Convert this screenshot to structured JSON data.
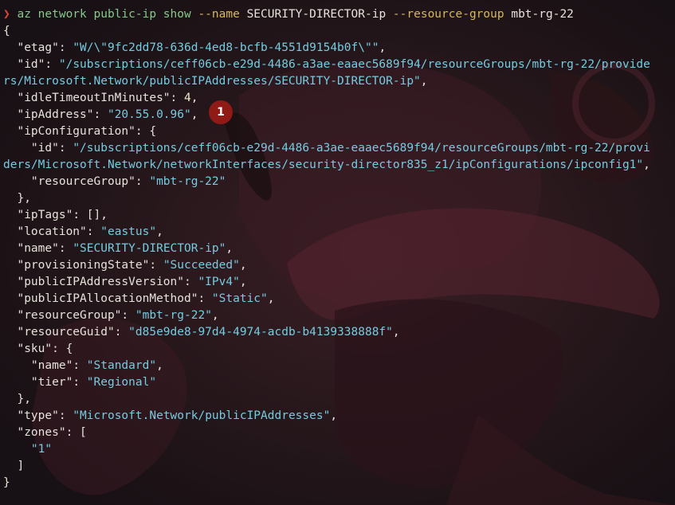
{
  "prompt": {
    "arrow": "❯",
    "command": "az network public-ip show",
    "name_flag": "--name",
    "name_value": "SECURITY-DIRECTOR-ip",
    "rg_flag": "--resource-group",
    "rg_value": "mbt-rg-22"
  },
  "output": {
    "open_brace": "{",
    "close_brace": "}",
    "etag_key": "\"etag\"",
    "etag_value": "\"W/\\\"9fc2dd78-636d-4ed8-bcfb-4551d9154b0f\\\"\"",
    "id_key": "\"id\"",
    "id_value_line1": "\"/subscriptions/ceff06cb-e29d-4486-a3ae-eaaec5689f94/resourceGroups/mbt-rg-22/provide",
    "id_value_line2": "rs/Microsoft.Network/publicIPAddresses/SECURITY-DIRECTOR-ip\"",
    "idle_key": "\"idleTimeoutInMinutes\"",
    "idle_value": "4",
    "ip_key": "\"ipAddress\"",
    "ip_value": "\"20.55.0.96\"",
    "ipconfig_key": "\"ipConfiguration\"",
    "ipconfig_id_key": "\"id\"",
    "ipconfig_id_line1": "\"/subscriptions/ceff06cb-e29d-4486-a3ae-eaaec5689f94/resourceGroups/mbt-rg-22/provi",
    "ipconfig_id_line2": "ders/Microsoft.Network/networkInterfaces/security-director835_z1/ipConfigurations/ipconfig1\"",
    "ipconfig_rg_key": "\"resourceGroup\"",
    "ipconfig_rg_value": "\"mbt-rg-22\"",
    "iptags_key": "\"ipTags\"",
    "iptags_value": "[]",
    "location_key": "\"location\"",
    "location_value": "\"eastus\"",
    "name_key": "\"name\"",
    "name_value": "\"SECURITY-DIRECTOR-ip\"",
    "prov_key": "\"provisioningState\"",
    "prov_value": "\"Succeeded\"",
    "ipver_key": "\"publicIPAddressVersion\"",
    "ipver_value": "\"IPv4\"",
    "alloc_key": "\"publicIPAllocationMethod\"",
    "alloc_value": "\"Static\"",
    "rg_key": "\"resourceGroup\"",
    "rg_value": "\"mbt-rg-22\"",
    "guid_key": "\"resourceGuid\"",
    "guid_value": "\"d85e9de8-97d4-4974-acdb-b4139338888f\"",
    "sku_key": "\"sku\"",
    "sku_name_key": "\"name\"",
    "sku_name_value": "\"Standard\"",
    "sku_tier_key": "\"tier\"",
    "sku_tier_value": "\"Regional\"",
    "type_key": "\"type\"",
    "type_value": "\"Microsoft.Network/publicIPAddresses\"",
    "zones_key": "\"zones\"",
    "zones_item": "\"1\""
  },
  "badge": {
    "label": "1"
  },
  "colors": {
    "background": "#1c1417",
    "string": "#76cbe0",
    "command": "#86c98a",
    "flag": "#d6b85a",
    "prompt_arrow": "#e2453a",
    "badge": "#8f1a16"
  }
}
